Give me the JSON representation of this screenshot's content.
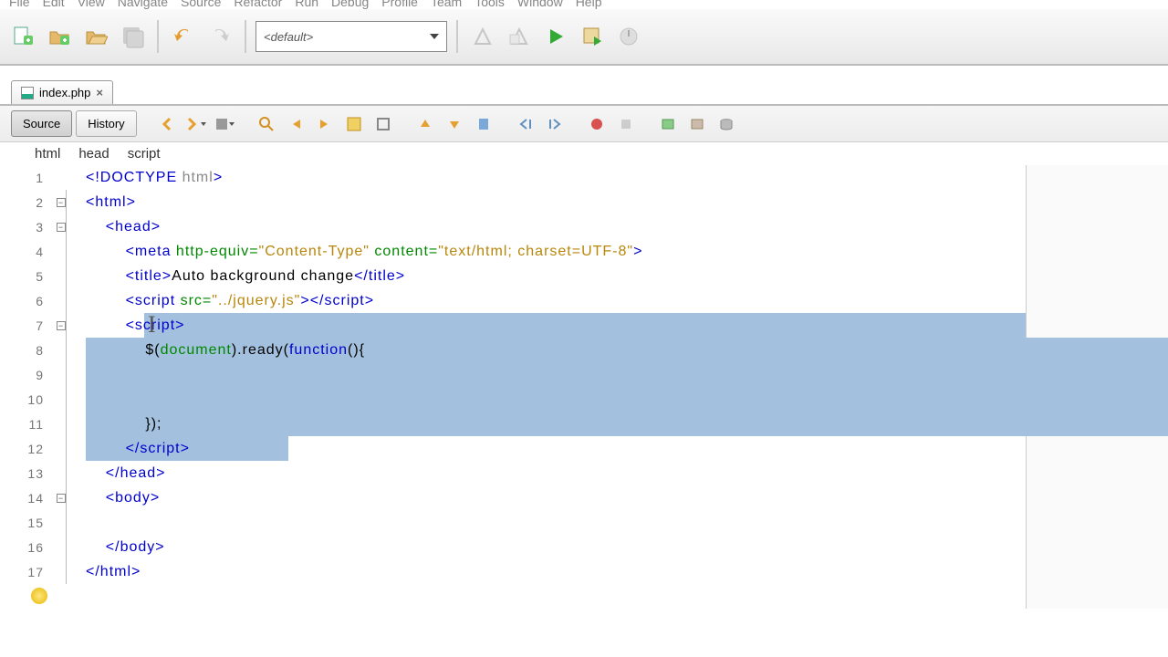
{
  "menu": [
    "File",
    "Edit",
    "View",
    "Navigate",
    "Source",
    "Refactor",
    "Run",
    "Debug",
    "Profile",
    "Team",
    "Tools",
    "Window",
    "Help"
  ],
  "toolbar": {
    "default_combo": "<default>"
  },
  "tab": {
    "filename": "index.php"
  },
  "views": {
    "source": "Source",
    "history": "History"
  },
  "breadcrumb": [
    "html",
    "head",
    "script"
  ],
  "code": {
    "l1_a": "<!DOCTYPE ",
    "l1_b": "html",
    "l1_c": ">",
    "l2_a": "<html>",
    "l3_a": "    <head>",
    "l4_a": "        <meta ",
    "l4_b": "http-equiv=",
    "l4_c": "\"Content-Type\"",
    "l4_d": " content=",
    "l4_e": "\"text/html; charset=UTF-8\"",
    "l4_f": ">",
    "l5_a": "        <title>",
    "l5_b": "Auto background change",
    "l5_c": "</title>",
    "l6_a": "        <script ",
    "l6_b": "src=",
    "l6_c": "\"../jquery.js\"",
    "l6_d": "></",
    "l6_e": "script>",
    "l7_a": "        <script>",
    "l8_a": "            $(",
    "l8_b": "document",
    "l8_c": ").ready(",
    "l8_d": "function",
    "l8_e": "(){",
    "l9_a": "",
    "l10_a": "",
    "l11_a": "            });",
    "l12_a": "        </",
    "l12_b": "script>",
    "l13_a": "    </head>",
    "l14_a": "    <body>",
    "l15_a": "",
    "l16_a": "    </body>",
    "l17_a": "</html>"
  }
}
